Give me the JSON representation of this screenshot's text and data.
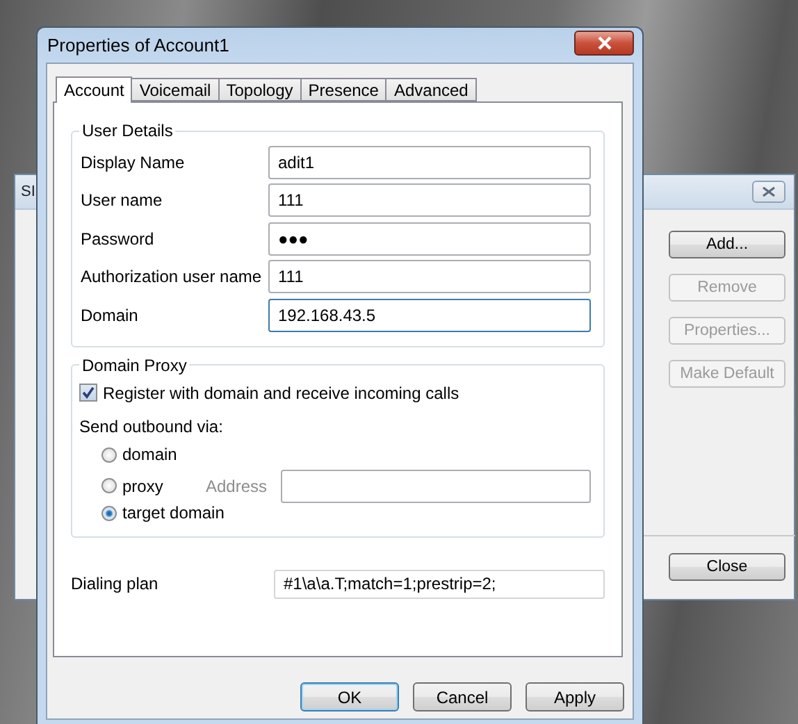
{
  "background_window": {
    "title": "SI",
    "buttons": [
      {
        "label": "Add...",
        "disabled": false
      },
      {
        "label": "Remove",
        "disabled": true
      },
      {
        "label": "Properties...",
        "disabled": true
      },
      {
        "label": "Make Default",
        "disabled": true
      }
    ],
    "close_button": {
      "label": "Close"
    }
  },
  "dialog": {
    "title": "Properties of Account1",
    "tabs": [
      {
        "label": "Account",
        "selected": true
      },
      {
        "label": "Voicemail",
        "selected": false
      },
      {
        "label": "Topology",
        "selected": false
      },
      {
        "label": "Presence",
        "selected": false
      },
      {
        "label": "Advanced",
        "selected": false
      }
    ],
    "user_details": {
      "legend": "User Details",
      "fields": [
        {
          "label": "Display Name",
          "value": "adit1",
          "focused": false
        },
        {
          "label": "User name",
          "value": "111",
          "focused": false
        },
        {
          "label": "Password",
          "value": "●●●",
          "focused": false
        },
        {
          "label": "Authorization user name",
          "value": "111",
          "focused": false
        },
        {
          "label": "Domain",
          "value": "192.168.43.5",
          "focused": true
        }
      ]
    },
    "domain_proxy": {
      "legend": "Domain Proxy",
      "register": {
        "label": "Register with domain and receive incoming calls",
        "checked": true
      },
      "send_via_label": "Send outbound via:",
      "options": [
        {
          "label": "domain",
          "selected": false
        },
        {
          "label": "proxy",
          "selected": false
        },
        {
          "label": "target domain",
          "selected": true
        }
      ],
      "address": {
        "label": "Address",
        "disabled": true
      }
    },
    "dialing_plan": {
      "label": "Dialing plan",
      "value": "#1\\a\\a.T;match=1;prestrip=2;"
    },
    "buttons": [
      {
        "label": "OK",
        "default": true
      },
      {
        "label": "Cancel",
        "default": false
      },
      {
        "label": "Apply",
        "default": false
      }
    ]
  }
}
